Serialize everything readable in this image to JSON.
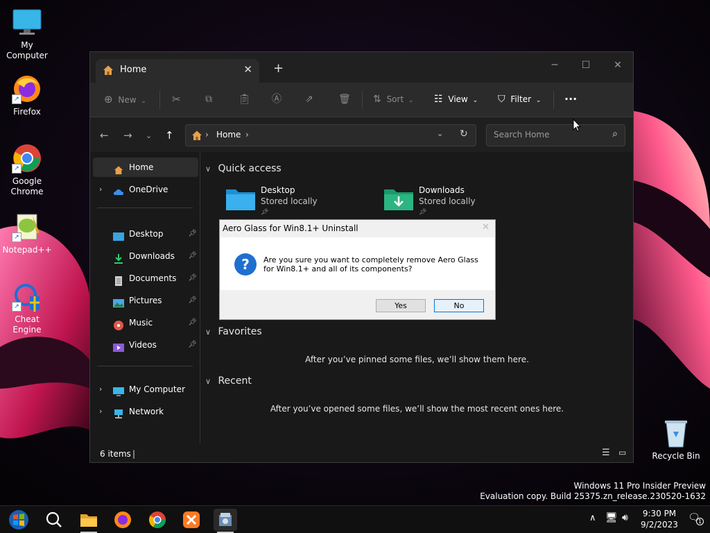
{
  "desktop": {
    "icons": [
      {
        "label": "My Computer",
        "icon": "monitor-icon"
      },
      {
        "label": "Firefox",
        "icon": "firefox-icon"
      },
      {
        "label": "Google Chrome",
        "icon": "chrome-icon"
      },
      {
        "label": "Notepad++",
        "icon": "notepadpp-icon"
      },
      {
        "label": "Cheat Engine",
        "icon": "cheat-engine-icon"
      },
      {
        "label": "Recycle Bin",
        "icon": "recycle-bin-icon"
      }
    ],
    "watermark": {
      "line1": "Windows 11 Pro Insider Preview",
      "line2": "Evaluation copy. Build 25375.zn_release.230520-1632"
    }
  },
  "explorer": {
    "tab_title": "Home",
    "toolbar": {
      "new_label": "New",
      "sort_label": "Sort",
      "view_label": "View",
      "filter_label": "Filter"
    },
    "address": {
      "location": "Home"
    },
    "search": {
      "placeholder": "Search Home"
    },
    "sidebar": {
      "home": "Home",
      "onedrive": "OneDrive",
      "pinned": [
        "Desktop",
        "Downloads",
        "Documents",
        "Pictures",
        "Music",
        "Videos"
      ],
      "my_computer": "My Computer",
      "network": "Network"
    },
    "quick_access": {
      "title": "Quick access",
      "items": [
        {
          "name": "Desktop",
          "sub": "Stored locally"
        },
        {
          "name": "Downloads",
          "sub": "Stored locally"
        }
      ]
    },
    "favorites": {
      "title": "Favorites",
      "empty": "After you’ve pinned some files, we’ll show them here."
    },
    "recent": {
      "title": "Recent",
      "empty": "After you’ve opened some files, we’ll show the most recent ones here."
    },
    "status": {
      "items": "6 items"
    }
  },
  "dialog": {
    "title": "Aero Glass for Win8.1+ Uninstall",
    "message": "Are you sure you want to completely remove Aero Glass for Win8.1+ and all of its components?",
    "yes": "Yes",
    "no": "No",
    "default_button": "No"
  },
  "taskbar": {
    "apps": [
      "start-icon",
      "search-icon",
      "file-explorer-icon",
      "firefox-icon",
      "chrome-icon",
      "xampp-icon",
      "installer-icon"
    ],
    "active_app": "installer-icon",
    "time": "9:30 PM",
    "date": "9/2/2023",
    "notification_count": "1"
  },
  "colors": {
    "accent": "#0078d7",
    "window_bg": "#191919",
    "dialog_bg": "#f0f0f0"
  }
}
